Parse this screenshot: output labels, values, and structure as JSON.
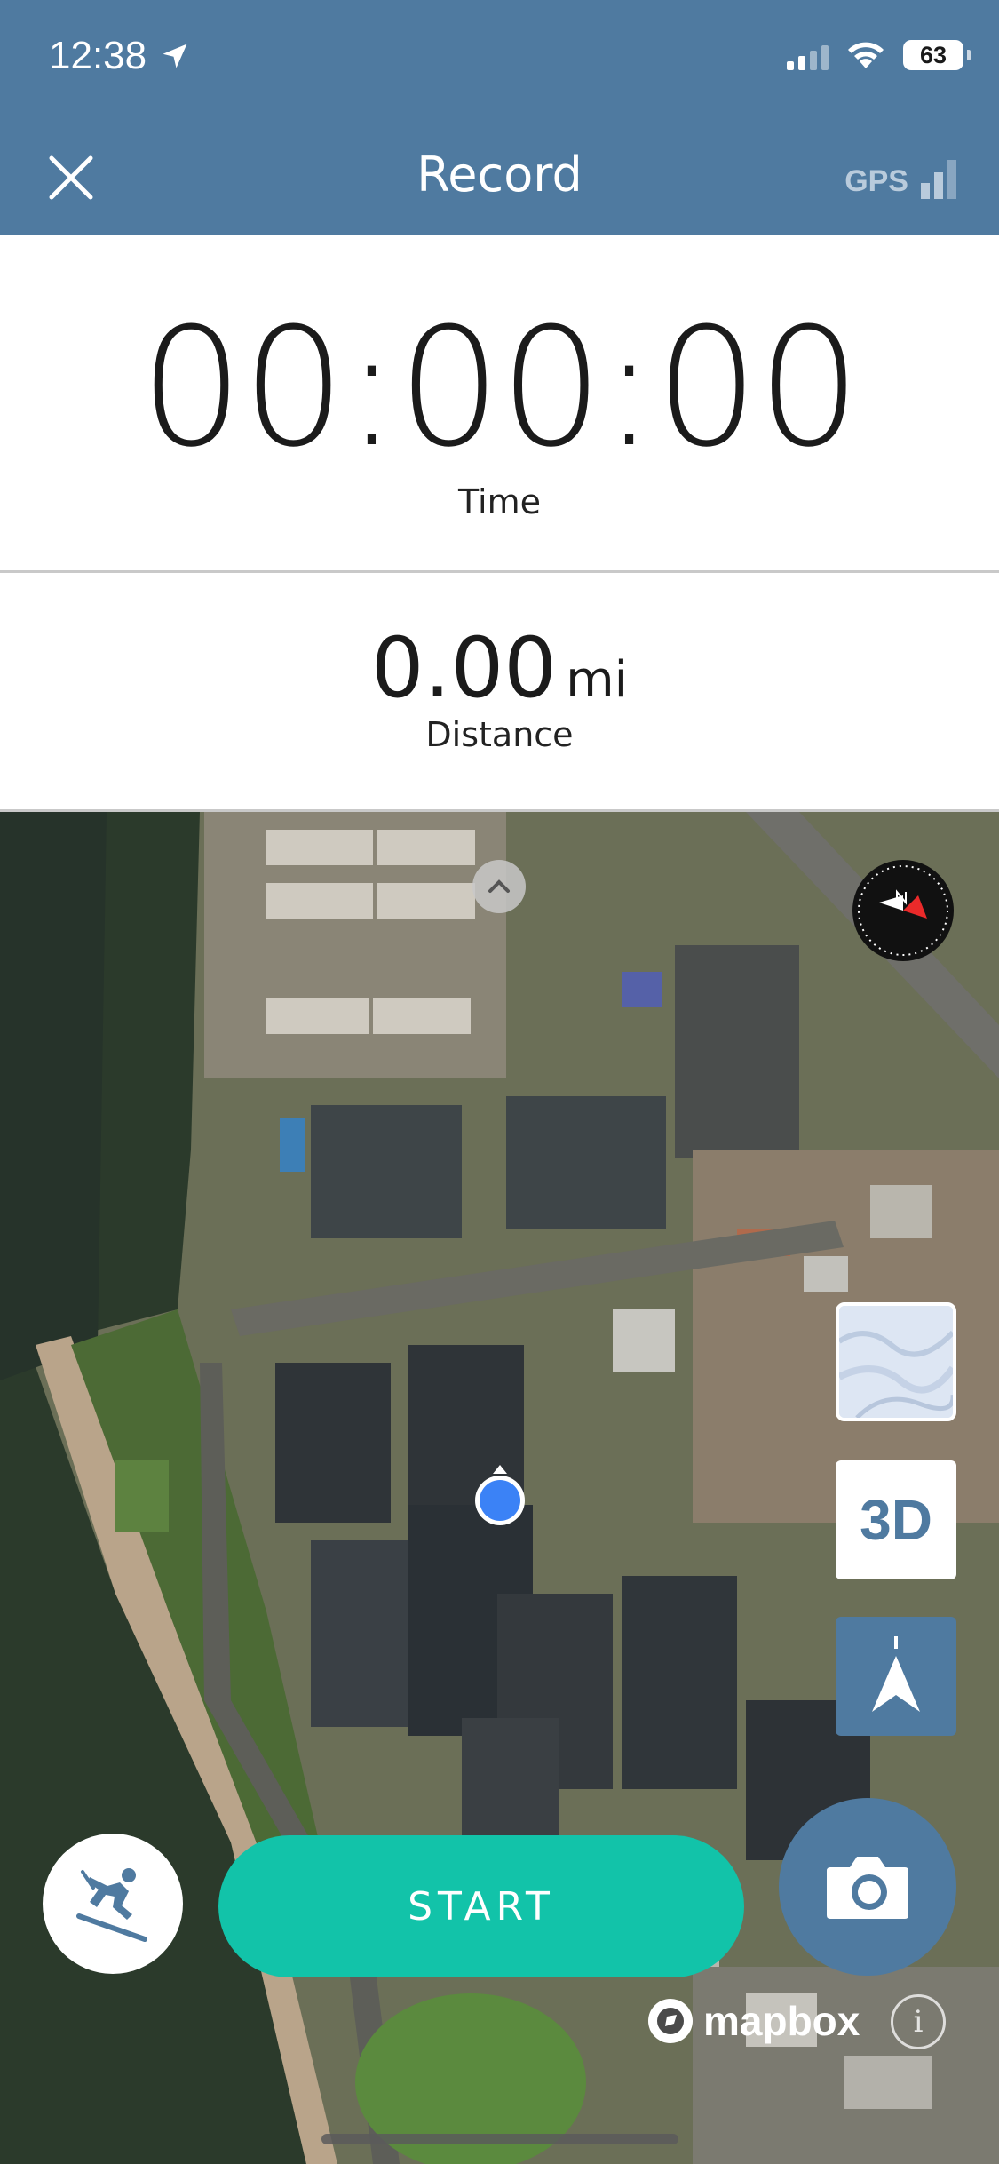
{
  "status_bar": {
    "time": "12:38",
    "battery": "63"
  },
  "header": {
    "title": "Record",
    "gps_label": "GPS"
  },
  "stats": {
    "time_value": "00:00:00",
    "time_label": "Time",
    "distance_value": "0.00",
    "distance_unit": "mi",
    "distance_label": "Distance"
  },
  "map": {
    "three_d_label": "3D",
    "start_label": "START",
    "attribution": "mapbox",
    "info_label": "i"
  },
  "icons": {
    "close": "close-icon",
    "location_arrow": "location-arrow-icon",
    "compass": "compass-icon",
    "navigation": "navigation-arrow-icon",
    "activity": "skiing-icon",
    "camera": "camera-icon"
  },
  "colors": {
    "header_bg": "#4f7aa0",
    "start_button": "#12c3a9",
    "location_dot": "#3b82f6"
  }
}
